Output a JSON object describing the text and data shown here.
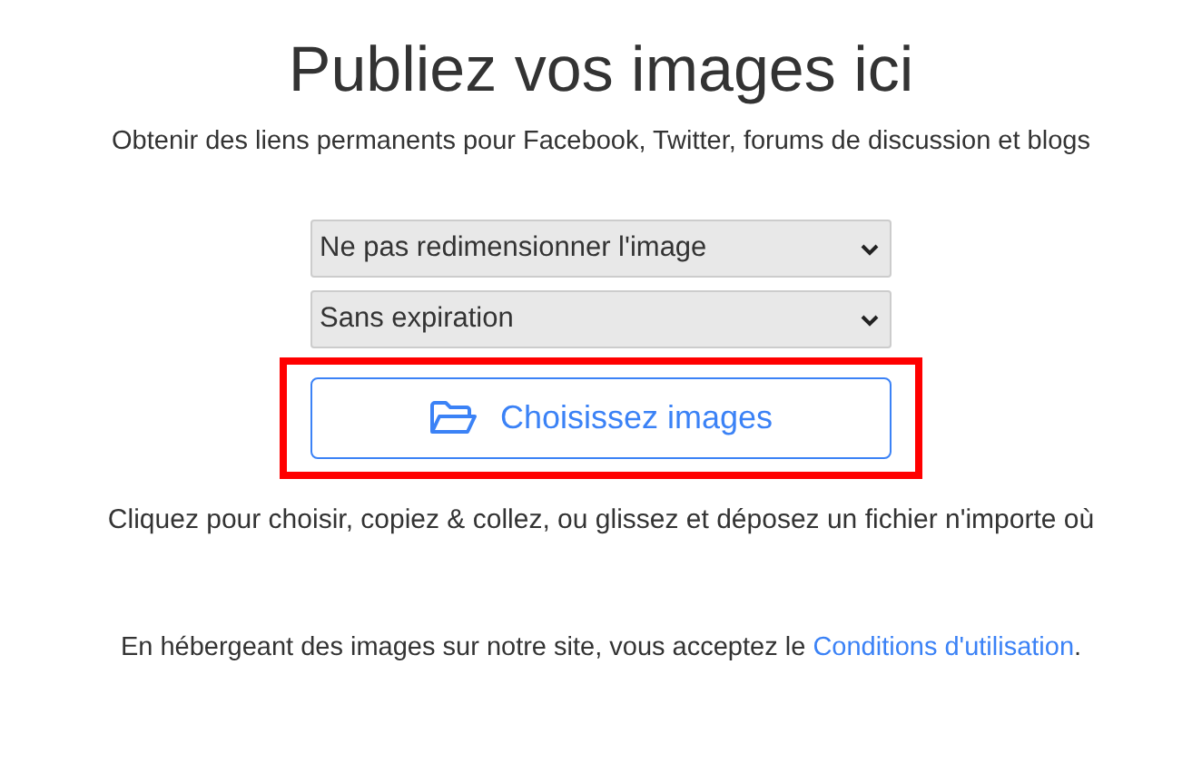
{
  "title": "Publiez vos images ici",
  "subtitle": "Obtenir des liens permanents pour Facebook, Twitter, forums de discussion et blogs",
  "dropdowns": [
    {
      "value": "Ne pas redimensionner l'image"
    },
    {
      "value": "Sans expiration"
    }
  ],
  "upload_button": {
    "label": "Choisissez images",
    "highlighted": true
  },
  "hint": "Cliquez pour choisir, copiez & collez, ou glissez et déposez un fichier n'importe où",
  "terms": {
    "text": "En hébergeant des images sur notre site, vous acceptez le ",
    "link": "Conditions d'utilisation",
    "after": "."
  }
}
